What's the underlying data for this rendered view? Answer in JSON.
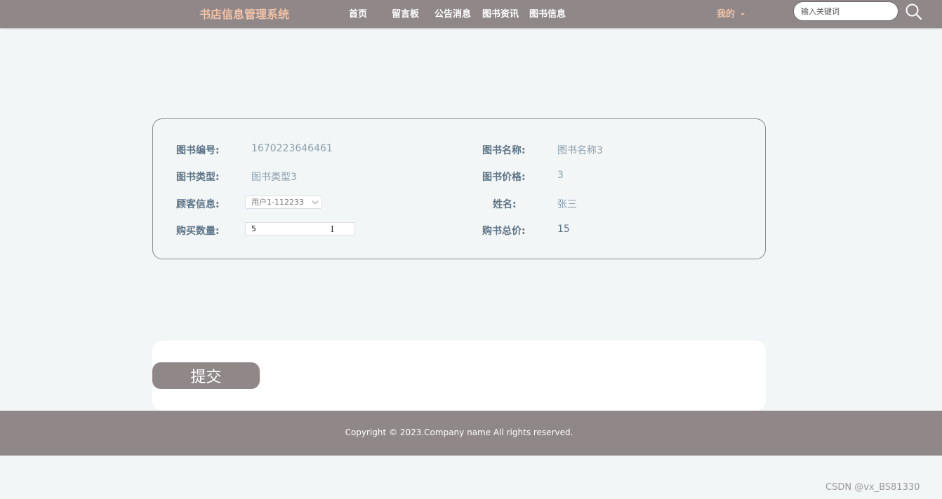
{
  "header": {
    "brand": "书店信息管理系统",
    "nav": [
      {
        "label": "首页"
      },
      {
        "label": "留言板"
      },
      {
        "label": "公告消息"
      },
      {
        "label": "图书资讯"
      },
      {
        "label": "图书信息"
      }
    ],
    "mine_label": "我的",
    "search_placeholder": "输入关键词",
    "search_icon": "search-icon"
  },
  "form": {
    "book_no_label": "图书编号:",
    "book_no_value": "1670223646461",
    "book_name_label": "图书名称:",
    "book_name_value": "图书名称3",
    "book_type_label": "图书类型:",
    "book_type_value": "图书类型3",
    "book_price_label": "图书价格:",
    "book_price_value": "3",
    "customer_label": "顾客信息:",
    "customer_value": "用户1-112233",
    "name_label": "姓名:",
    "name_value": "张三",
    "qty_label": "购买数量:",
    "qty_value": "5",
    "total_label": "购书总价:",
    "total_value": "15"
  },
  "actions": {
    "submit_label": "提交"
  },
  "footer": {
    "copyright": "Copyright © 2023.Company name All rights reserved."
  },
  "watermark": "CSDN @vx_BS81330",
  "colors": {
    "header_bg": "#8f8788",
    "brand": "#f3c3a8",
    "label": "#5d7486",
    "value": "#8aa0ad"
  }
}
